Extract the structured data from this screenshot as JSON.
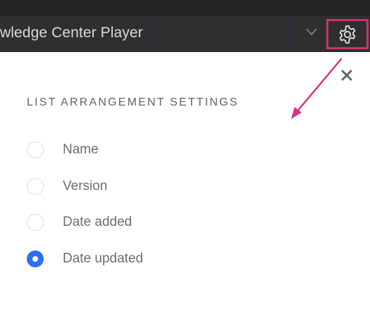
{
  "header": {
    "title": "wledge Center Player",
    "dropdown_icon": "chevron-down-icon",
    "settings_icon": "gear-icon"
  },
  "panel": {
    "heading": "LIST ARRANGEMENT SETTINGS",
    "close_icon": "close-icon",
    "options": [
      {
        "label": "Name",
        "selected": false
      },
      {
        "label": "Version",
        "selected": false
      },
      {
        "label": "Date added",
        "selected": false
      },
      {
        "label": "Date updated",
        "selected": true
      }
    ]
  },
  "colors": {
    "header_bg": "#2f2f2f",
    "highlight": "#c8336f",
    "radio_selected": "#2f6cf5",
    "annotation_arrow": "#d63384"
  }
}
